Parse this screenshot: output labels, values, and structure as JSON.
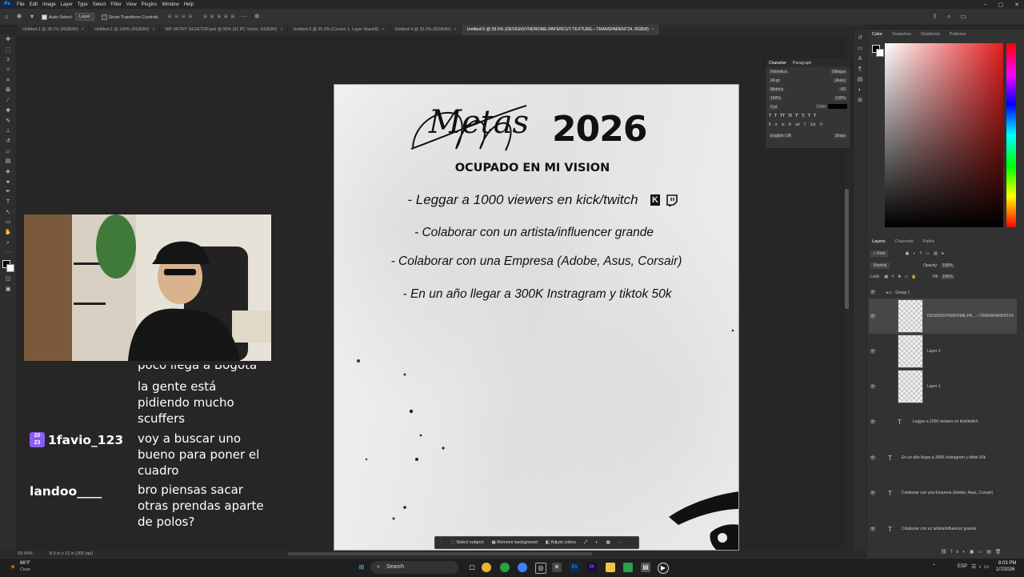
{
  "menu": {
    "items": [
      "File",
      "Edit",
      "Image",
      "Layer",
      "Type",
      "Select",
      "Filter",
      "View",
      "Plugins",
      "Window",
      "Help"
    ]
  },
  "options_bar": {
    "auto_select_label": "Auto-Select:",
    "auto_select_value": "Layer",
    "show_transform_label": "Show Transform Controls"
  },
  "tabs": [
    {
      "label": "Untitled-1 @ 39.1% (RGB/8#)"
    },
    {
      "label": "Untitled-2 @ 149% (RGB/8#)"
    },
    {
      "label": "WP SNTRY DESKTOP.psd @ 50% (01 PC Vision, RGB/8#)"
    },
    {
      "label": "Untitled-3 @ 25.3% (Curves 1, Layer Mask/8)"
    },
    {
      "label": "Untitled-4 @ 33.3% (RGB/8#)"
    },
    {
      "label": "Untitled-5 @ 59.5% (DESIGNSYNDROME-PAPERCUT-TEXTURE---TRANSPARENT24, RGB/8)"
    }
  ],
  "document": {
    "title_script": "Metas",
    "title_year": "2026",
    "subtitle": "OCUPADO EN MI VISION",
    "lines": [
      "- Leggar a 1000 viewers en kick/twitch",
      "- Colaborar con un artista/influencer grande",
      "- Colaborar con una Empresa (Adobe, Asus, Corsair)",
      "- En un año llegar a 300K Instragram y tiktok 50k"
    ]
  },
  "context_bar": {
    "select_subject": "Select subject",
    "remove_background": "Remove background",
    "adjust_colors": "Adjust colors"
  },
  "status": {
    "zoom": "59.54%",
    "doc_size": "8.5 in x 11 in (300 ppi)"
  },
  "chat": {
    "partial_top": "poco llega a Bogota",
    "msg1_lines": [
      "la gente está",
      "pidiendo mucho",
      "scuffers"
    ],
    "msg2_user": "1favio_123",
    "msg2_lines": [
      "voy a buscar uno",
      "bueno para poner el",
      "cuadro"
    ],
    "msg3_user": "landoo____",
    "msg3_lines": [
      "bro piensas sacar",
      "otras prendas aparte",
      "de polos?"
    ]
  },
  "character_panel": {
    "tab_character": "Character",
    "tab_paragraph": "Paragraph",
    "font": "Helvetica",
    "style": "Oblique",
    "size": "24 pt",
    "leading": "(Auto)",
    "kerning": "Metrics",
    "tracking": "-60",
    "scale_v": "100%",
    "scale_h": "100%",
    "baseline": "0 pt",
    "color_label": "Color:",
    "language": "English: UK",
    "aa": "Sharp"
  },
  "color_panel": {
    "tabs": [
      "Color",
      "Swatches",
      "Gradients",
      "Patterns"
    ],
    "accent": "#e41e1e"
  },
  "layers_panel": {
    "tabs": [
      "Layers",
      "Channels",
      "Paths"
    ],
    "kind": "Kind",
    "blend": "Normal",
    "opacity_label": "Opacity:",
    "opacity": "100%",
    "lock_label": "Lock:",
    "fill_label": "Fill:",
    "fill": "100%",
    "group": "Group 1",
    "layers": [
      {
        "name": "DESIGNSYNDROME-PA...---TRANSPARENT24",
        "kind": "image"
      },
      {
        "name": "Layer 2",
        "kind": "image"
      },
      {
        "name": "Layer 1",
        "kind": "image"
      },
      {
        "name": "Leggar a 1000 viewers en kick/twitch",
        "kind": "text"
      },
      {
        "name": "En un año llegar a 300K Instragram y tiktok 50k",
        "kind": "text"
      },
      {
        "name": "Colaborar con una Empresa (Adobe, Asus, Corsair)",
        "kind": "text"
      },
      {
        "name": "Colaborar con un artista/influencer grande",
        "kind": "text"
      }
    ]
  },
  "taskbar": {
    "weather_temp": "66°F",
    "weather_desc": "Clear",
    "search": "Search",
    "lang": "ESP",
    "time": "8:03 PM",
    "date": "1/7/2026"
  }
}
